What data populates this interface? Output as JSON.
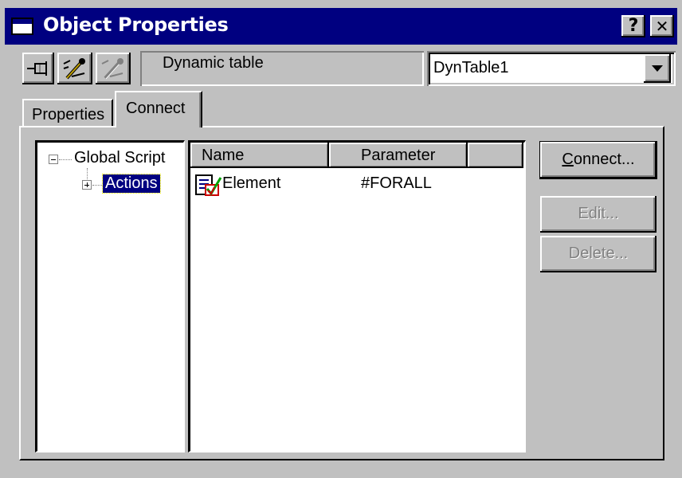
{
  "window": {
    "title": "Object Properties",
    "help_glyph": "?",
    "close_glyph": "✕"
  },
  "toolbar": {
    "pin_icon": "pin-icon",
    "wand_icon": "wand-icon",
    "wand_disabled_icon": "wand-disabled-icon",
    "object_type": "Dynamic table",
    "object_name": "DynTable1"
  },
  "tabs": [
    {
      "label": "Properties",
      "active": false
    },
    {
      "label": "Connect",
      "active": true
    }
  ],
  "tree": {
    "root_label": "Global Script",
    "child_label": "Actions"
  },
  "list": {
    "columns": [
      "Name",
      "Parameter"
    ],
    "rows": [
      {
        "name": "Element",
        "parameter": "#FORALL",
        "icon": "element-checklist-icon"
      }
    ]
  },
  "buttons": {
    "connect": "Connect...",
    "edit": "Edit...",
    "delete": "Delete..."
  },
  "colors": {
    "titlebar": "#000080",
    "face": "#c0c0c0",
    "selection": "#000080"
  }
}
